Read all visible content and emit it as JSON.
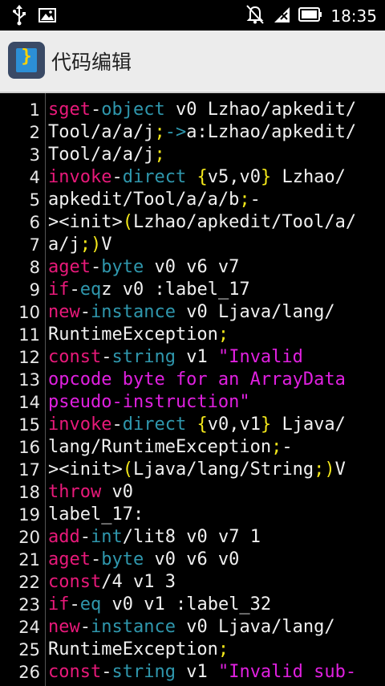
{
  "status_bar": {
    "time": "18:35",
    "icons": [
      "usb-icon",
      "image-icon",
      "mute-icon",
      "signal-icon",
      "battery-icon"
    ]
  },
  "app_bar": {
    "title": "代码编辑",
    "icon": "code-file-icon"
  },
  "editor": {
    "lines": [
      {
        "n": "1",
        "tokens": [
          [
            "kw",
            "sget"
          ],
          [
            "sep",
            "-"
          ],
          [
            "kw2",
            "object"
          ],
          [
            "txt",
            " v0 Lzhao/apkedit/"
          ]
        ]
      },
      {
        "n": "2",
        "tokens": [
          [
            "txt",
            "Tool/a/a/j"
          ],
          [
            "pun",
            ";"
          ],
          [
            "kw2",
            "->"
          ],
          [
            "txt",
            "a:Lzhao/apkedit/"
          ]
        ]
      },
      {
        "n": "3",
        "tokens": [
          [
            "txt",
            "Tool/a/a/j"
          ],
          [
            "pun",
            ";"
          ]
        ]
      },
      {
        "n": "4",
        "tokens": [
          [
            "kw",
            "invoke"
          ],
          [
            "sep",
            "-"
          ],
          [
            "kw2",
            "direct"
          ],
          [
            "txt",
            " "
          ],
          [
            "pun",
            "{"
          ],
          [
            "txt",
            "v5,v0"
          ],
          [
            "pun",
            "}"
          ],
          [
            "txt",
            " Lzhao/"
          ]
        ]
      },
      {
        "n": "5",
        "tokens": [
          [
            "txt",
            "apkedit/Tool/a/a/b"
          ],
          [
            "pun",
            ";"
          ],
          [
            "txt",
            "-"
          ]
        ]
      },
      {
        "n": "6",
        "tokens": [
          [
            "txt",
            "><init>"
          ],
          [
            "pun",
            "("
          ],
          [
            "txt",
            "Lzhao/apkedit/Tool/a/"
          ]
        ]
      },
      {
        "n": "7",
        "tokens": [
          [
            "txt",
            "a/j"
          ],
          [
            "pun",
            ";)"
          ],
          [
            "txt",
            "V"
          ]
        ]
      },
      {
        "n": "8",
        "tokens": [
          [
            "kw",
            "aget"
          ],
          [
            "sep",
            "-"
          ],
          [
            "kw2",
            "byte"
          ],
          [
            "txt",
            " v0 v6 v7"
          ]
        ]
      },
      {
        "n": "9",
        "tokens": [
          [
            "kw",
            "if"
          ],
          [
            "sep",
            "-"
          ],
          [
            "kw2",
            "eq"
          ],
          [
            "txt",
            "z v0 :label_17"
          ]
        ]
      },
      {
        "n": "10",
        "tokens": [
          [
            "kw",
            "new"
          ],
          [
            "sep",
            "-"
          ],
          [
            "kw2",
            "instance"
          ],
          [
            "txt",
            " v0 Ljava/lang/"
          ]
        ]
      },
      {
        "n": "11",
        "tokens": [
          [
            "txt",
            "RuntimeException"
          ],
          [
            "pun",
            ";"
          ]
        ]
      },
      {
        "n": "12",
        "tokens": [
          [
            "kw",
            "const"
          ],
          [
            "sep",
            "-"
          ],
          [
            "kw2",
            "string"
          ],
          [
            "txt",
            " v1 "
          ],
          [
            "str",
            "\"Invalid"
          ]
        ]
      },
      {
        "n": "13",
        "tokens": [
          [
            "str",
            "opcode byte for an ArrayData"
          ]
        ]
      },
      {
        "n": "14",
        "tokens": [
          [
            "str",
            "pseudo-instruction\""
          ]
        ]
      },
      {
        "n": "15",
        "tokens": [
          [
            "kw",
            "invoke"
          ],
          [
            "sep",
            "-"
          ],
          [
            "kw2",
            "direct"
          ],
          [
            "txt",
            " "
          ],
          [
            "pun",
            "{"
          ],
          [
            "txt",
            "v0,v1"
          ],
          [
            "pun",
            "}"
          ],
          [
            "txt",
            " Ljava/"
          ]
        ]
      },
      {
        "n": "16",
        "tokens": [
          [
            "txt",
            "lang/RuntimeException"
          ],
          [
            "pun",
            ";"
          ],
          [
            "txt",
            "-"
          ]
        ]
      },
      {
        "n": "17",
        "tokens": [
          [
            "txt",
            "><init>"
          ],
          [
            "pun",
            "("
          ],
          [
            "txt",
            "Ljava/lang/String"
          ],
          [
            "pun",
            ";)"
          ],
          [
            "txt",
            "V"
          ]
        ]
      },
      {
        "n": "18",
        "tokens": [
          [
            "kw",
            "throw"
          ],
          [
            "txt",
            " v0"
          ]
        ]
      },
      {
        "n": "19",
        "tokens": [
          [
            "txt",
            "label_17:"
          ]
        ]
      },
      {
        "n": "20",
        "tokens": [
          [
            "kw",
            "add"
          ],
          [
            "sep",
            "-"
          ],
          [
            "kw2",
            "int"
          ],
          [
            "txt",
            "/lit8 v0 v7 1"
          ]
        ]
      },
      {
        "n": "21",
        "tokens": [
          [
            "kw",
            "aget"
          ],
          [
            "sep",
            "-"
          ],
          [
            "kw2",
            "byte"
          ],
          [
            "txt",
            " v0 v6 v0"
          ]
        ]
      },
      {
        "n": "22",
        "tokens": [
          [
            "kw",
            "const"
          ],
          [
            "txt",
            "/4 v1 3"
          ]
        ]
      },
      {
        "n": "23",
        "tokens": [
          [
            "kw",
            "if"
          ],
          [
            "sep",
            "-"
          ],
          [
            "kw2",
            "eq"
          ],
          [
            "txt",
            " v0 v1 :label_32"
          ]
        ]
      },
      {
        "n": "24",
        "tokens": [
          [
            "kw",
            "new"
          ],
          [
            "sep",
            "-"
          ],
          [
            "kw2",
            "instance"
          ],
          [
            "txt",
            " v0 Ljava/lang/"
          ]
        ]
      },
      {
        "n": "25",
        "tokens": [
          [
            "txt",
            "RuntimeException"
          ],
          [
            "pun",
            ";"
          ]
        ]
      },
      {
        "n": "26",
        "tokens": [
          [
            "kw",
            "const"
          ],
          [
            "sep",
            "-"
          ],
          [
            "kw2",
            "string"
          ],
          [
            "txt",
            " v1 "
          ],
          [
            "str",
            "\"Invalid sub-"
          ]
        ]
      }
    ]
  }
}
